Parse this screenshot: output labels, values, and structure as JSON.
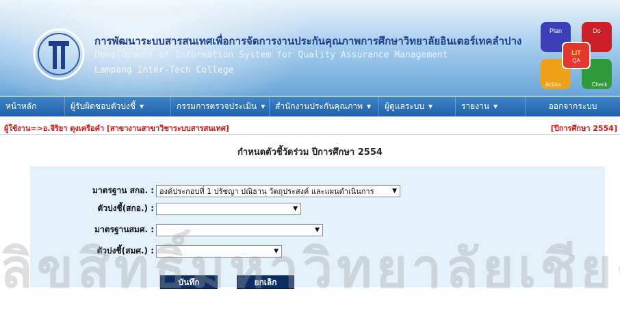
{
  "header": {
    "title_th": "การพัฒนาระบบสารสนเทศเพื่อการจัดการงานประกันคุณภาพการศึกษาวิทยาลัยอินเตอร์เทคลำปาง",
    "title_en": "Development of Information System for Quality Assurance Management",
    "college": "Lampang Inter-Tech College",
    "pdca": {
      "plan": "Plan",
      "do": "Do",
      "check": "Check",
      "action": "Action",
      "center": "LIT",
      "center_sub": "QA"
    }
  },
  "nav": {
    "items": [
      {
        "label": "หน้าหลัก",
        "has_menu": false
      },
      {
        "label": "ผู้รับผิดชอบตัวบ่งชี้",
        "has_menu": true
      },
      {
        "label": "กรรมการตรวจประเมิน",
        "has_menu": true
      },
      {
        "label": "สำนักงานประกันคุณภาพ",
        "has_menu": true
      },
      {
        "label": "ผู้ดูแลระบบ",
        "has_menu": true
      },
      {
        "label": "รายงาน",
        "has_menu": true
      },
      {
        "label": "ออกจากระบบ",
        "has_menu": false
      }
    ]
  },
  "user_info": "ผู้ใช้งาน=>อ.จิริยา ตุงเครือคำ [สาขางานสาขาวิชาระบบสารสนเทศ]",
  "year_info": "[ปีการศึกษา 2554]",
  "page_title": "กำหนดตัวชี้วัดร่วม ปีการศึกษา 2554",
  "form": {
    "standard_label": "มาตรฐาน สกอ. :",
    "standard_value": "องค์ประกอบที่ 1 ปรัชญา ปณิธาน วัตถุประสงค์ และแผนดำเนินการ",
    "indicator_label": "ตัวบ่งชี้(สกอ.) :",
    "indicator_value": "",
    "smk_standard_label": "มาตรฐานสมศ. :",
    "smk_standard_value": "",
    "smk_indicator_label": "ตัวบ่งชี้(สมศ.) :",
    "smk_indicator_value": "",
    "save_label": "บันทึก",
    "cancel_label": "ยกเลิก"
  },
  "watermark": "ลิขสิทธิ์มหาวิทยาลัยเชียงใหม่",
  "colors": {
    "nav": "#1f5fa8",
    "panel": "#e3f1fb",
    "button": "#0c2f63",
    "alert_text": "#dd1111"
  }
}
